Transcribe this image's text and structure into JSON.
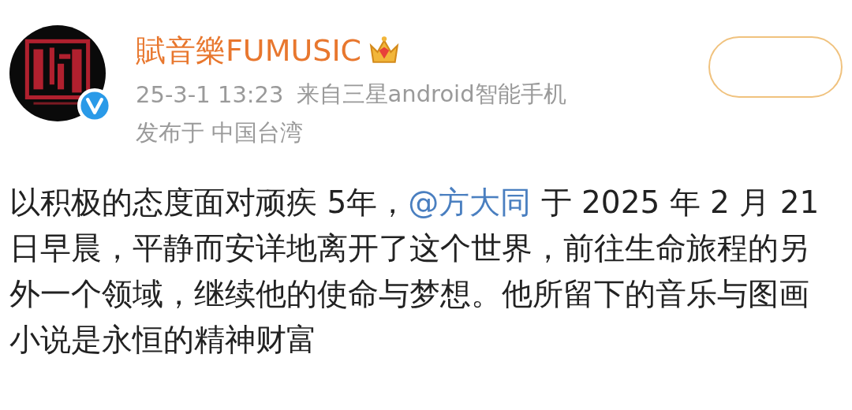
{
  "post": {
    "author": {
      "name": "賦音樂FUMUSIC",
      "verified": true
    },
    "meta": {
      "time": "25-3-1 13:23",
      "source": "来自三星android智能手机",
      "location": "发布于 中国台湾"
    },
    "follow_button": {
      "kind": "outline"
    },
    "body": {
      "before": "以积极的态度面对顽疾 5年，",
      "mention": "@方大同",
      "after": " 于 2025 年 2 月 21日早晨，平静而安详地离开了这个世界，前往生命旅程的另外一个领域，继续他的使命与梦想。他所留下的音乐与图画小说是永恒的精神财富"
    }
  }
}
